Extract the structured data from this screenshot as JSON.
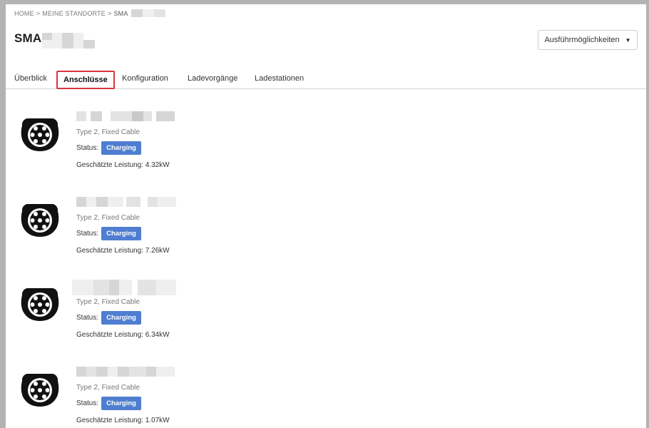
{
  "breadcrumb": {
    "home": "HOME",
    "sep": ">",
    "standorte": "MEINE STANDORTE",
    "current": "SMA"
  },
  "page": {
    "title": "SMA"
  },
  "actions": {
    "label": "Ausführmöglichkeiten"
  },
  "tabs": [
    {
      "label": "Überblick"
    },
    {
      "label": "Anschlüsse",
      "active": true
    },
    {
      "label": "Konfiguration"
    },
    {
      "label": "Ladevorgänge"
    },
    {
      "label": "Ladestationen"
    }
  ],
  "connectors": [
    {
      "type": "Type 2, Fixed Cable",
      "status_label": "Status:",
      "status": "Charging",
      "power_label": "Geschätzte Leistung:",
      "power": "4.32kW",
      "power_text": "Geschätzte Leistung: 4.32kW"
    },
    {
      "type": "Type 2, Fixed Cable",
      "status_label": "Status:",
      "status": "Charging",
      "power_label": "Geschätzte Leistung:",
      "power": "7.26kW",
      "power_text": "Geschätzte Leistung: 7.26kW"
    },
    {
      "type": "Type 2, Fixed Cable",
      "status_label": "Status:",
      "status": "Charging",
      "power_label": "Geschätzte Leistung:",
      "power": "6.34kW",
      "power_text": "Geschätzte Leistung: 6.34kW"
    },
    {
      "type": "Type 2, Fixed Cable",
      "status_label": "Status:",
      "status": "Charging",
      "power_label": "Geschätzte Leistung:",
      "power": "1.07kW",
      "power_text": "Geschätzte Leistung: 1.07kW"
    }
  ],
  "colors": {
    "badge": "#4f7ed1",
    "active_tab_border": "#d9363e",
    "frame": "#b3b3b3"
  },
  "icons": {
    "connector": "type2-plug-icon",
    "dropdown": "caret-down-icon"
  }
}
